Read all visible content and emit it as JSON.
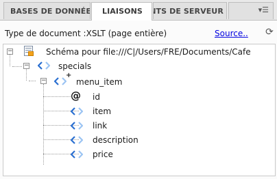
{
  "tabs": [
    {
      "label": "BASES DE DONNÉES"
    },
    {
      "label": "LIAISONS"
    },
    {
      "label": "COMPORTEMENTS DE SERVEUR"
    }
  ],
  "menu_icon": "panel-options-icon",
  "info": {
    "doctype": "Type de document :XSLT (page entière)",
    "source_link": "Source..",
    "refresh_icon": "refresh-icon"
  },
  "tree": {
    "root": "Schéma pour file:///C|/Users/FRE/Documents/Cafe",
    "specials": "specials",
    "menu_item": "menu_item",
    "children": [
      {
        "label": "id",
        "kind": "attribute"
      },
      {
        "label": "item",
        "kind": "element"
      },
      {
        "label": "link",
        "kind": "element"
      },
      {
        "label": "description",
        "kind": "element"
      },
      {
        "label": "price",
        "kind": "element"
      }
    ]
  },
  "colors": {
    "link": "#0000e0",
    "element_icon_blue": "#2a6fd1",
    "element_icon_light": "#9bc4f3"
  }
}
